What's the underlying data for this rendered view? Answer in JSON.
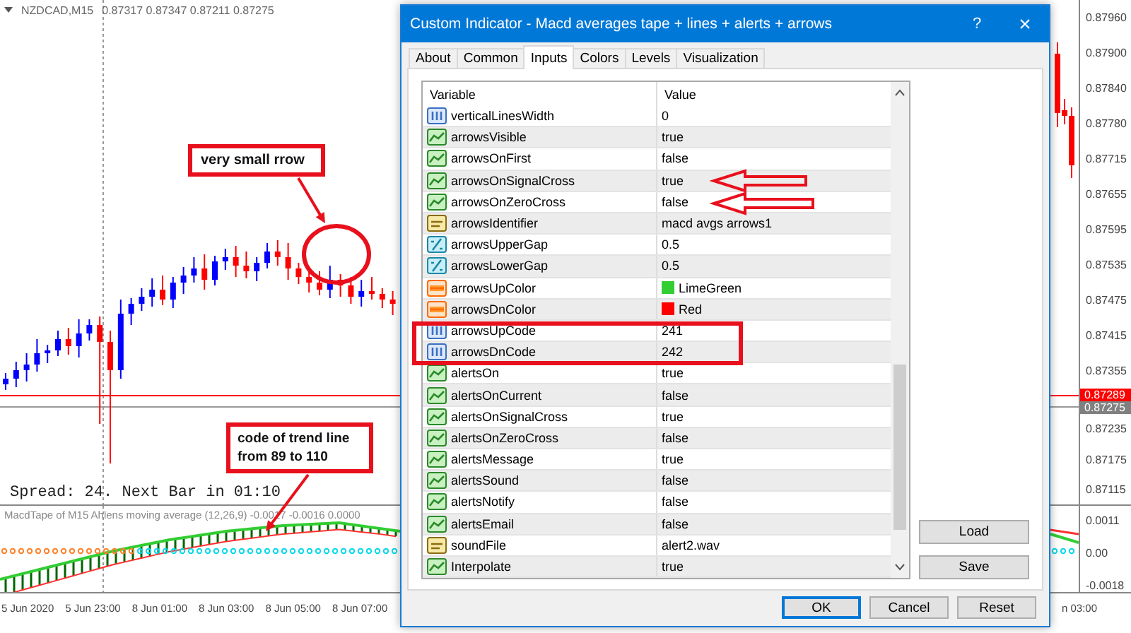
{
  "chart": {
    "symbol": "NZDCAD,M15",
    "quotes": "0.87317 0.87347 0.87211 0.87275",
    "spread_info": "Spread: 24. Next Bar in 01:10",
    "price_axis": [
      "0.87960",
      "0.87900",
      "0.87840",
      "0.87780",
      "0.87715",
      "0.87655",
      "0.87595",
      "0.87535",
      "0.87475",
      "0.87415",
      "0.87355"
    ],
    "ask": "0.87289",
    "bid": "0.87275",
    "price_axis_lower": [
      "0.87235",
      "0.87175",
      "0.87115"
    ],
    "indicator_title": "MacdTape of M15 Ahlens moving average (12,26,9) -0.0017 -0.0016 0.0000",
    "indicator_axis": [
      "0.0011",
      "0.00",
      "-0.0018"
    ],
    "time_axis": [
      "5 Jun 2020",
      "5 Jun 23:00",
      "8 Jun 01:00",
      "8 Jun 03:00",
      "8 Jun 05:00",
      "8 Jun 07:00"
    ],
    "time_axis_right": "n 03:00"
  },
  "notes": [
    "very small rrow",
    "code of trend line from 89 to 110"
  ],
  "dialog": {
    "title": "Custom Indicator - Macd averages tape + lines + alerts + arrows",
    "help_button": "?",
    "close_button": "×",
    "tabs": [
      {
        "label": "About",
        "selected": false
      },
      {
        "label": "Common",
        "selected": false
      },
      {
        "label": "Inputs",
        "selected": true
      },
      {
        "label": "Colors",
        "selected": false
      },
      {
        "label": "Levels",
        "selected": false
      },
      {
        "label": "Visualization",
        "selected": false
      }
    ],
    "columns": [
      "Variable",
      "Value"
    ],
    "rows": [
      {
        "kind": "int",
        "name": "verticalLinesWidth",
        "value": "0"
      },
      {
        "kind": "bool",
        "name": "arrowsVisible",
        "value": "true"
      },
      {
        "kind": "bool",
        "name": "arrowsOnFirst",
        "value": "false"
      },
      {
        "kind": "bool",
        "name": "arrowsOnSignalCross",
        "value": "true"
      },
      {
        "kind": "bool",
        "name": "arrowsOnZeroCross",
        "value": "false"
      },
      {
        "kind": "string",
        "name": "arrowsIdentifier",
        "value": "macd avgs arrows1"
      },
      {
        "kind": "double",
        "name": "arrowsUpperGap",
        "value": "0.5"
      },
      {
        "kind": "double",
        "name": "arrowsLowerGap",
        "value": "0.5"
      },
      {
        "kind": "color",
        "name": "arrowsUpColor",
        "value": "LimeGreen",
        "color": "#32cd32"
      },
      {
        "kind": "color",
        "name": "arrowsDnColor",
        "value": "Red",
        "color": "#ff0000"
      },
      {
        "kind": "int",
        "name": "arrowsUpCode",
        "value": "241"
      },
      {
        "kind": "int",
        "name": "arrowsDnCode",
        "value": "242"
      },
      {
        "kind": "bool",
        "name": "alertsOn",
        "value": "true"
      },
      {
        "kind": "bool",
        "name": "alertsOnCurrent",
        "value": "false"
      },
      {
        "kind": "bool",
        "name": "alertsOnSignalCross",
        "value": "true"
      },
      {
        "kind": "bool",
        "name": "alertsOnZeroCross",
        "value": "false"
      },
      {
        "kind": "bool",
        "name": "alertsMessage",
        "value": "true"
      },
      {
        "kind": "bool",
        "name": "alertsSound",
        "value": "false"
      },
      {
        "kind": "bool",
        "name": "alertsNotify",
        "value": "false"
      },
      {
        "kind": "bool",
        "name": "alertsEmail",
        "value": "false"
      },
      {
        "kind": "string",
        "name": "soundFile",
        "value": "alert2.wav"
      },
      {
        "kind": "bool",
        "name": "Interpolate",
        "value": "true"
      }
    ],
    "side_buttons": [
      "Load",
      "Save"
    ],
    "buttons": [
      {
        "label": "OK",
        "default": true
      },
      {
        "label": "Cancel",
        "default": false
      },
      {
        "label": "Reset",
        "default": false
      }
    ]
  }
}
